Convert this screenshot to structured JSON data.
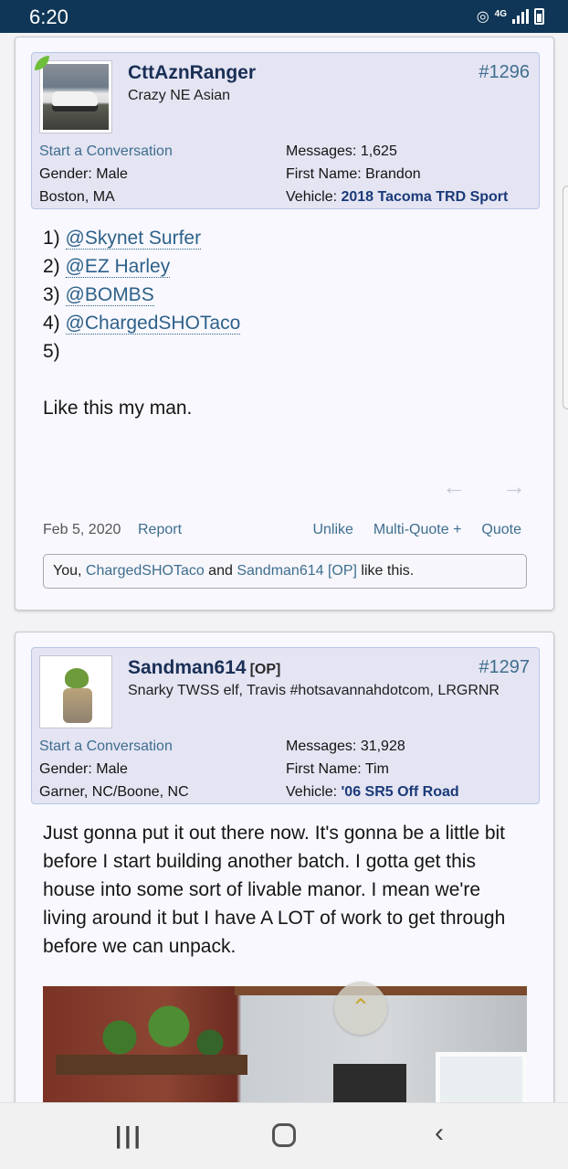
{
  "status": {
    "time": "6:20",
    "network": "4G"
  },
  "posts": [
    {
      "username": "CttAznRanger",
      "user_title": "Crazy NE Asian",
      "post_number": "#1296",
      "start_conversation": "Start a Conversation",
      "gender": "Gender:  Male",
      "location": "Boston, MA",
      "messages": "Messages:  1,625",
      "first_name": "First Name:  Brandon",
      "vehicle_label": "Vehicle:  ",
      "vehicle": "2018 Tacoma TRD Sport",
      "list": [
        {
          "num": "1)",
          "mention": "@Skynet Surfer"
        },
        {
          "num": "2)",
          "mention": "@EZ Harley"
        },
        {
          "num": "3)",
          "mention": "@BOMBS"
        },
        {
          "num": "4)",
          "mention": "@ChargedSHOTaco"
        },
        {
          "num": "5)",
          "mention": ""
        }
      ],
      "body": "Like this my man.",
      "date": "Feb 5, 2020",
      "report": "Report",
      "unlike": "Unlike",
      "multiquote": "Multi-Quote +",
      "quote": "Quote",
      "likes": {
        "you": "You, ",
        "u1": "ChargedSHOTaco",
        "and": " and ",
        "u2": "Sandman614 [OP]",
        "tail": " like this."
      }
    },
    {
      "username": "Sandman614",
      "op_tag": "[OP]",
      "user_title": "Snarky TWSS elf, Travis #hotsavannahdotcom, LRGRNR",
      "post_number": "#1297",
      "start_conversation": "Start a Conversation",
      "gender": "Gender:  Male",
      "location": "Garner, NC/Boone, NC",
      "messages": "Messages:  31,928",
      "first_name": "First Name:  Tim",
      "vehicle_label": "Vehicle:  ",
      "vehicle": "'06 SR5 Off Road",
      "body": "Just gonna put it out there now. It's gonna be a little bit before I start building another batch. I gotta get this house into some sort of livable manor. I mean we're living around it but I have A LOT of work to get through before we can unpack."
    }
  ]
}
